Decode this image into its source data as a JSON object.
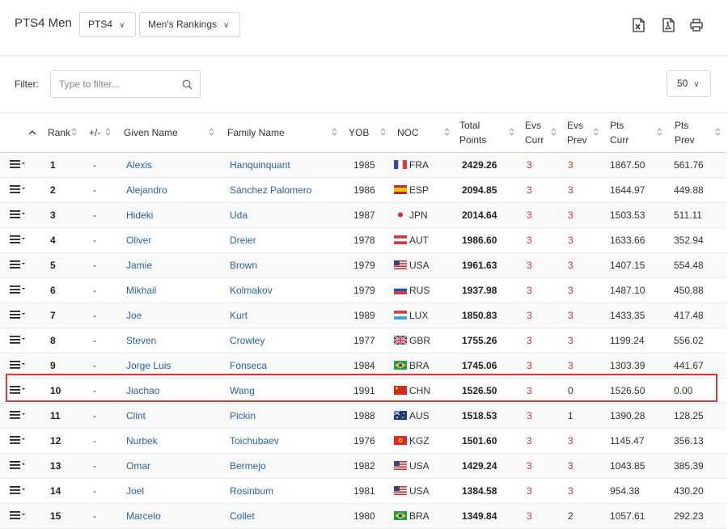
{
  "header": {
    "title": "PTS4 Men",
    "class_select": "PTS4",
    "ranking_select": "Men's Rankings",
    "tools": [
      "excel-icon",
      "pdf-icon",
      "print-icon"
    ]
  },
  "filter": {
    "label": "Filter:",
    "placeholder": "Type to filter...",
    "page_size": "50"
  },
  "columns": {
    "rank": "Rank",
    "change": "+/-",
    "given": "Given Name",
    "family": "Family Name",
    "yob": "YOB",
    "noc": "NOC",
    "total1": "Total",
    "total2": "Points",
    "evs_curr1": "Evs",
    "evs_curr2": "Curr",
    "evs_prev1": "Evs",
    "evs_prev2": "Prev",
    "pts_curr1": "Pts",
    "pts_curr2": "Curr",
    "pts_prev1": "Pts",
    "pts_prev2": "Prev"
  },
  "rows": [
    {
      "rank": "1",
      "change": "-",
      "given": "Alexis",
      "family": "Hanquinquant",
      "yob": "1985",
      "noc": "FRA",
      "flag": "fra",
      "total": "2429.26",
      "evs_curr": "3",
      "evs_prev": "3",
      "pts_curr": "1867.50",
      "pts_prev": "561.76"
    },
    {
      "rank": "2",
      "change": "-",
      "given": "Alejandro",
      "family": "Sánchez Palomero",
      "yob": "1986",
      "noc": "ESP",
      "flag": "esp",
      "total": "2094.85",
      "evs_curr": "3",
      "evs_prev": "3",
      "pts_curr": "1644.97",
      "pts_prev": "449.88"
    },
    {
      "rank": "3",
      "change": "-",
      "given": "Hideki",
      "family": "Uda",
      "yob": "1987",
      "noc": "JPN",
      "flag": "jpn",
      "total": "2014.64",
      "evs_curr": "3",
      "evs_prev": "3",
      "pts_curr": "1503.53",
      "pts_prev": "511.11"
    },
    {
      "rank": "4",
      "change": "-",
      "given": "Oliver",
      "family": "Dreier",
      "yob": "1978",
      "noc": "AUT",
      "flag": "aut",
      "total": "1986.60",
      "evs_curr": "3",
      "evs_prev": "3",
      "pts_curr": "1633.66",
      "pts_prev": "352.94"
    },
    {
      "rank": "5",
      "change": "-",
      "given": "Jamie",
      "family": "Brown",
      "yob": "1979",
      "noc": "USA",
      "flag": "usa",
      "total": "1961.63",
      "evs_curr": "3",
      "evs_prev": "3",
      "pts_curr": "1407.15",
      "pts_prev": "554.48"
    },
    {
      "rank": "6",
      "change": "-",
      "given": "Mikhail",
      "family": "Kolmakov",
      "yob": "1979",
      "noc": "RUS",
      "flag": "rus",
      "total": "1937.98",
      "evs_curr": "3",
      "evs_prev": "3",
      "pts_curr": "1487.10",
      "pts_prev": "450.88"
    },
    {
      "rank": "7",
      "change": "-",
      "given": "Joe",
      "family": "Kurt",
      "yob": "1989",
      "noc": "LUX",
      "flag": "lux",
      "total": "1850.83",
      "evs_curr": "3",
      "evs_prev": "3",
      "pts_curr": "1433.35",
      "pts_prev": "417.48"
    },
    {
      "rank": "8",
      "change": "-",
      "given": "Steven",
      "family": "Crowley",
      "yob": "1977",
      "noc": "GBR",
      "flag": "gbr",
      "total": "1755.26",
      "evs_curr": "3",
      "evs_prev": "3",
      "pts_curr": "1199.24",
      "pts_prev": "556.02"
    },
    {
      "rank": "9",
      "change": "-",
      "given": "Jorge Luis",
      "family": "Fonseca",
      "yob": "1984",
      "noc": "BRA",
      "flag": "bra",
      "total": "1745.06",
      "evs_curr": "3",
      "evs_prev": "3",
      "pts_curr": "1303.39",
      "pts_prev": "441.67"
    },
    {
      "rank": "10",
      "change": "-",
      "given": "Jiachao",
      "family": "Wang",
      "yob": "1991",
      "noc": "CHN",
      "flag": "chn",
      "total": "1526.50",
      "evs_curr": "3",
      "evs_prev": "0",
      "pts_curr": "1526.50",
      "pts_prev": "0.00"
    },
    {
      "rank": "11",
      "change": "-",
      "given": "Clint",
      "family": "Pickin",
      "yob": "1988",
      "noc": "AUS",
      "flag": "aus",
      "total": "1518.53",
      "evs_curr": "3",
      "evs_prev": "1",
      "pts_curr": "1390.28",
      "pts_prev": "128.25"
    },
    {
      "rank": "12",
      "change": "-",
      "given": "Nurbek",
      "family": "Toichubaev",
      "yob": "1976",
      "noc": "KGZ",
      "flag": "kgz",
      "total": "1501.60",
      "evs_curr": "3",
      "evs_prev": "3",
      "pts_curr": "1145.47",
      "pts_prev": "356.13"
    },
    {
      "rank": "13",
      "change": "-",
      "given": "Omar",
      "family": "Bermejo",
      "yob": "1982",
      "noc": "USA",
      "flag": "usa",
      "total": "1429.24",
      "evs_curr": "3",
      "evs_prev": "3",
      "pts_curr": "1043.85",
      "pts_prev": "385.39"
    },
    {
      "rank": "14",
      "change": "-",
      "given": "Joel",
      "family": "Rosinbum",
      "yob": "1981",
      "noc": "USA",
      "flag": "usa",
      "total": "1384.58",
      "evs_curr": "3",
      "evs_prev": "3",
      "pts_curr": "954.38",
      "pts_prev": "430.20"
    },
    {
      "rank": "15",
      "change": "-",
      "given": "Marcelo",
      "family": "Collet",
      "yob": "1980",
      "noc": "BRA",
      "flag": "bra",
      "total": "1349.84",
      "evs_curr": "3",
      "evs_prev": "2",
      "pts_curr": "1057.61",
      "pts_prev": "292.23"
    }
  ],
  "colors": {
    "link": "#2a62a8",
    "events": "#d0312d",
    "highlight": "#d9393b"
  }
}
